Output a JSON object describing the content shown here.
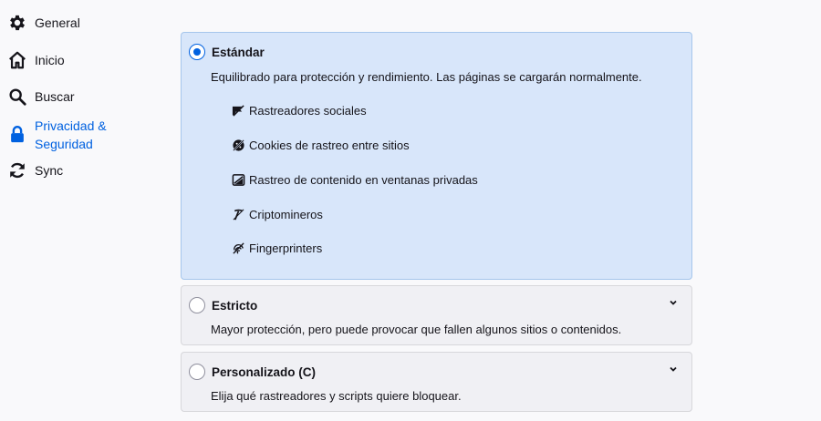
{
  "sidebar": {
    "items": [
      {
        "label": "General",
        "icon": "gear-icon"
      },
      {
        "label": "Inicio",
        "icon": "home-icon"
      },
      {
        "label": "Buscar",
        "icon": "search-icon"
      },
      {
        "label": "Privacidad & Seguridad",
        "icon": "lock-icon",
        "selected": true
      },
      {
        "label": "Sync",
        "icon": "sync-icon"
      }
    ]
  },
  "protection": {
    "standard": {
      "title": "Estándar",
      "description": "Equilibrado para protección y rendimiento. Las páginas se cargarán normalmente.",
      "selected": true,
      "trackers": [
        {
          "label": "Rastreadores sociales",
          "icon": "social-tracker-icon"
        },
        {
          "label": "Cookies de rastreo entre sitios",
          "icon": "cookie-icon"
        },
        {
          "label": "Rastreo de contenido en ventanas privadas",
          "icon": "content-tracker-icon"
        },
        {
          "label": "Criptomineros",
          "icon": "cryptominer-icon"
        },
        {
          "label": "Fingerprinters",
          "icon": "fingerprint-icon"
        }
      ]
    },
    "strict": {
      "title": "Estricto",
      "description": "Mayor protección, pero puede provocar que fallen algunos sitios o contenidos.",
      "selected": false
    },
    "custom": {
      "title": "Personalizado (C)",
      "description": "Elija qué rastreadores y scripts quiere bloquear.",
      "selected": false
    }
  },
  "colors": {
    "accent": "#0061e0",
    "selected_card_bg": "#d8e6fa",
    "card_bg": "#f0f0f4"
  }
}
